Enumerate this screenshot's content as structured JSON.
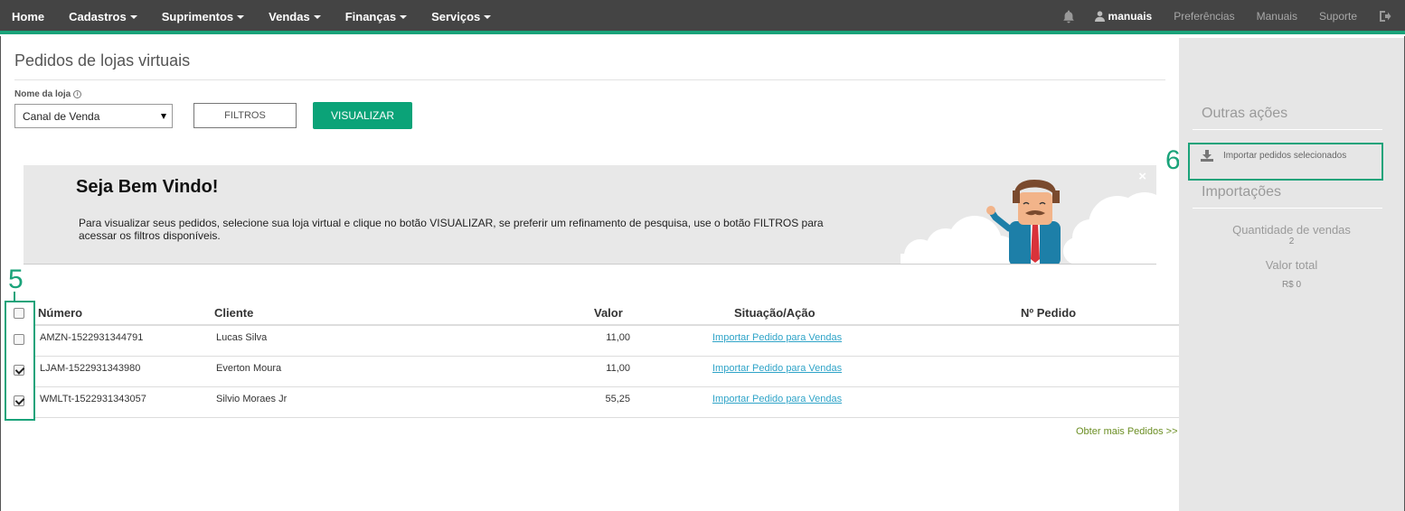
{
  "navbar": {
    "menu": [
      {
        "label": "Home",
        "dropdown": false
      },
      {
        "label": "Cadastros",
        "dropdown": true
      },
      {
        "label": "Suprimentos",
        "dropdown": true
      },
      {
        "label": "Vendas",
        "dropdown": true
      },
      {
        "label": "Finanças",
        "dropdown": true
      },
      {
        "label": "Serviços",
        "dropdown": true
      }
    ],
    "user": "manuais",
    "links": [
      "Preferências",
      "Manuais",
      "Suporte"
    ]
  },
  "page": {
    "title": "Pedidos de lojas virtuais",
    "store_label": "Nome da loja",
    "store_select_value": "Canal de Venda",
    "filters_button": "FILTROS",
    "view_button": "VISUALIZAR"
  },
  "banner": {
    "title": "Seja Bem Vindo!",
    "text": "Para visualizar seus pedidos, selecione sua loja virtual e clique no botão VISUALIZAR, se preferir um refinamento de pesquisa, use o botão FILTROS para acessar os filtros disponíveis.",
    "close": "×"
  },
  "annotations": {
    "marker5": "5",
    "marker6": "6"
  },
  "table": {
    "headers": {
      "numero": "Número",
      "cliente": "Cliente",
      "valor": "Valor",
      "situacao": "Situação/Ação",
      "pedido": "Nº Pedido"
    },
    "rows": [
      {
        "checked": false,
        "numero": "AMZN-1522931344791",
        "cliente": "Lucas Silva",
        "valor": "11,00",
        "acao": "Importar Pedido para Vendas"
      },
      {
        "checked": true,
        "numero": "LJAM-1522931343980",
        "cliente": "Everton Moura",
        "valor": "11,00",
        "acao": "Importar Pedido para Vendas"
      },
      {
        "checked": true,
        "numero": "WMLTt-1522931343057",
        "cliente": "Silvio Moraes Jr",
        "valor": "55,25",
        "acao": "Importar Pedido para Vendas"
      }
    ],
    "more_link": "Obter mais Pedidos >>"
  },
  "sidebar": {
    "other_actions_heading": "Outras ações",
    "import_selected": "Importar pedidos selecionados",
    "imports_heading": "Importações",
    "sales_qty_label": "Quantidade de vendas",
    "sales_qty_value": "2",
    "total_label": "Valor total",
    "total_value": "R$ 0"
  },
  "colors": {
    "accent": "#1aa37a",
    "primary_button": "#0ba378",
    "navbar": "#444444",
    "link": "#2fa4c8"
  }
}
